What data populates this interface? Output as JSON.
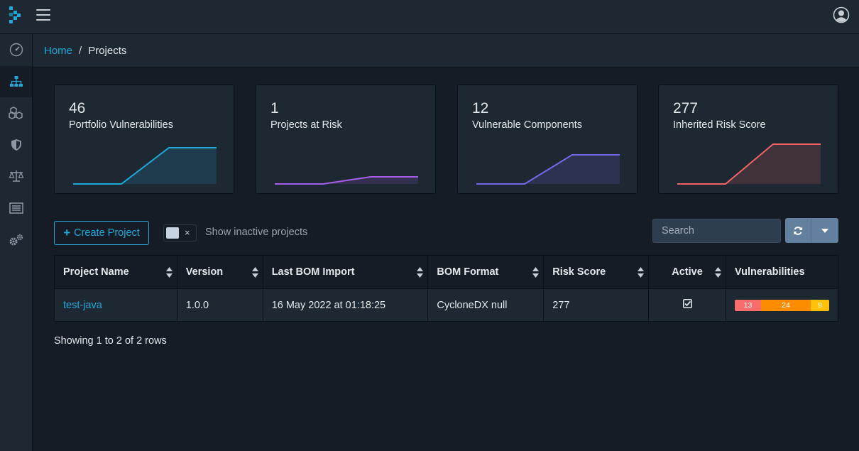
{
  "breadcrumb": {
    "home": "Home",
    "separator": "/",
    "current": "Projects"
  },
  "cards": [
    {
      "value": "46",
      "label": "Portfolio Vulnerabilities",
      "color": "#20a8d8"
    },
    {
      "value": "1",
      "label": "Projects at Risk",
      "color": "#a35fe8"
    },
    {
      "value": "12",
      "label": "Vulnerable Components",
      "color": "#7668e8"
    },
    {
      "value": "277",
      "label": "Inherited Risk Score",
      "color": "#f06464"
    }
  ],
  "toolbar": {
    "create_label": "Create Project",
    "toggle_label": "Show inactive projects",
    "toggle_x": "×",
    "search_placeholder": "Search"
  },
  "table": {
    "headers": [
      "Project Name",
      "Version",
      "Last BOM Import",
      "BOM Format",
      "Risk Score",
      "Active",
      "Vulnerabilities"
    ],
    "rows": [
      {
        "name": "test-java",
        "version": "1.0.0",
        "last_import": "16 May 2022 at 01:18:25",
        "format": "CycloneDX null",
        "risk_score": "277",
        "active": true,
        "vulns": {
          "high": "13",
          "medium": "24",
          "low": "9"
        }
      }
    ]
  },
  "colors": {
    "accent": "#20a8d8",
    "high": "#f86c6b",
    "medium": "#fd8c00",
    "low": "#ffc107"
  },
  "footer": {
    "rows_info": "Showing 1 to 2 of 2 rows"
  }
}
